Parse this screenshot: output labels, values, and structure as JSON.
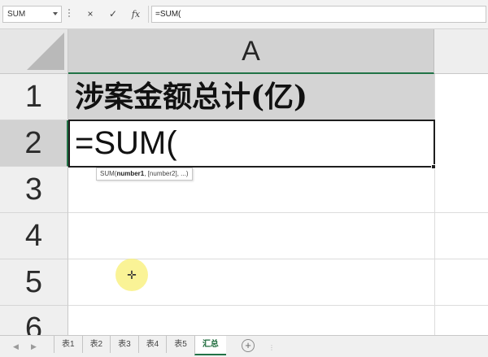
{
  "formula_bar": {
    "name_box": "SUM",
    "cancel_icon": "×",
    "enter_icon": "✓",
    "fx_label": "fx",
    "formula_value": "=SUM("
  },
  "grid": {
    "column_headers": [
      "A"
    ],
    "row_headers": [
      "1",
      "2",
      "3",
      "4",
      "5",
      "6"
    ],
    "cell_a1": "涉案金额总计(亿)",
    "cell_a2": "=SUM(",
    "tooltip_fn": "SUM(",
    "tooltip_arg1": "number1",
    "tooltip_rest": ", [number2], ...)"
  },
  "sheet_tabs": {
    "tabs": [
      "表1",
      "表2",
      "表3",
      "表4",
      "表5",
      "汇总"
    ],
    "active_tab": "汇总",
    "add_icon": "+"
  },
  "colors": {
    "accent": "#217346",
    "selected_header": "#d2d2d2",
    "cursor_highlight": "#f8f078"
  }
}
